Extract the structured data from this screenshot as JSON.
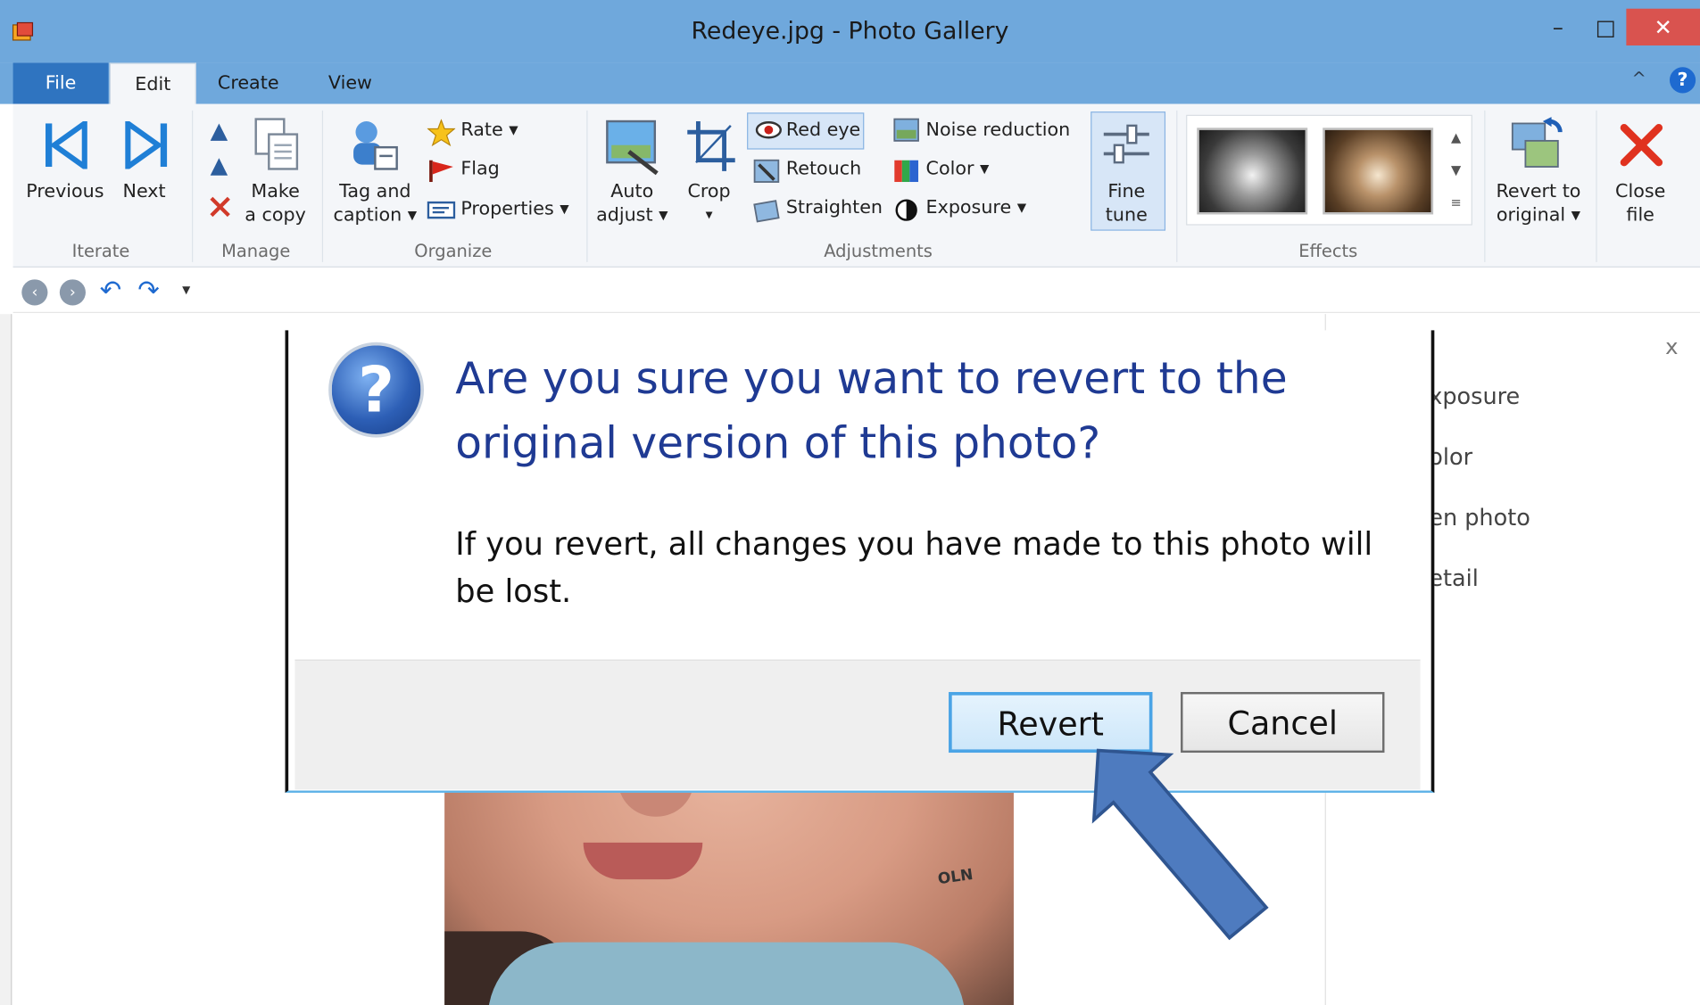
{
  "window": {
    "title": "Redeye.jpg - Photo Gallery",
    "minimize": "–",
    "maximize": "□",
    "close": "✕"
  },
  "tabs": [
    {
      "label": "File"
    },
    {
      "label": "Edit"
    },
    {
      "label": "Create"
    },
    {
      "label": "View"
    }
  ],
  "ribbon": {
    "iterate": {
      "previous": "Previous",
      "next": "Next",
      "group": "Iterate"
    },
    "manage": {
      "make_copy_1": "Make",
      "make_copy_2": "a copy",
      "group": "Manage"
    },
    "organize": {
      "tag_1": "Tag and",
      "tag_2": "caption ▾",
      "rate": "Rate ▾",
      "flag": "Flag",
      "properties": "Properties ▾",
      "group": "Organize"
    },
    "adjustments": {
      "auto_1": "Auto",
      "auto_2": "adjust ▾",
      "crop": "Crop",
      "crop_arrow": "▾",
      "red_eye": "Red eye",
      "retouch": "Retouch",
      "straighten": "Straighten",
      "noise": "Noise reduction",
      "color": "Color ▾",
      "exposure": "Exposure ▾",
      "fine_1": "Fine",
      "fine_2": "tune",
      "group": "Adjustments"
    },
    "effects": {
      "group": "Effects"
    },
    "revert": {
      "label_1": "Revert to",
      "label_2": "original ▾"
    },
    "close_file": {
      "label_1": "Close",
      "label_2": "file"
    }
  },
  "side_panel": {
    "items": [
      "xposure",
      "olor",
      "en photo",
      "etail"
    ],
    "close": "x"
  },
  "dialog": {
    "title": "Are you sure you want to revert to the original version of this photo?",
    "message": "If you revert, all changes you have made to this photo will be lost.",
    "revert_button": "Revert",
    "cancel_button": "Cancel"
  },
  "photo": {
    "watermark": "OLN"
  },
  "colors": {
    "titlebar": "#6fa8dc",
    "accent": "#2f74c0",
    "dialog_title": "#1f3a93",
    "arrow": "#4e7bbf"
  }
}
